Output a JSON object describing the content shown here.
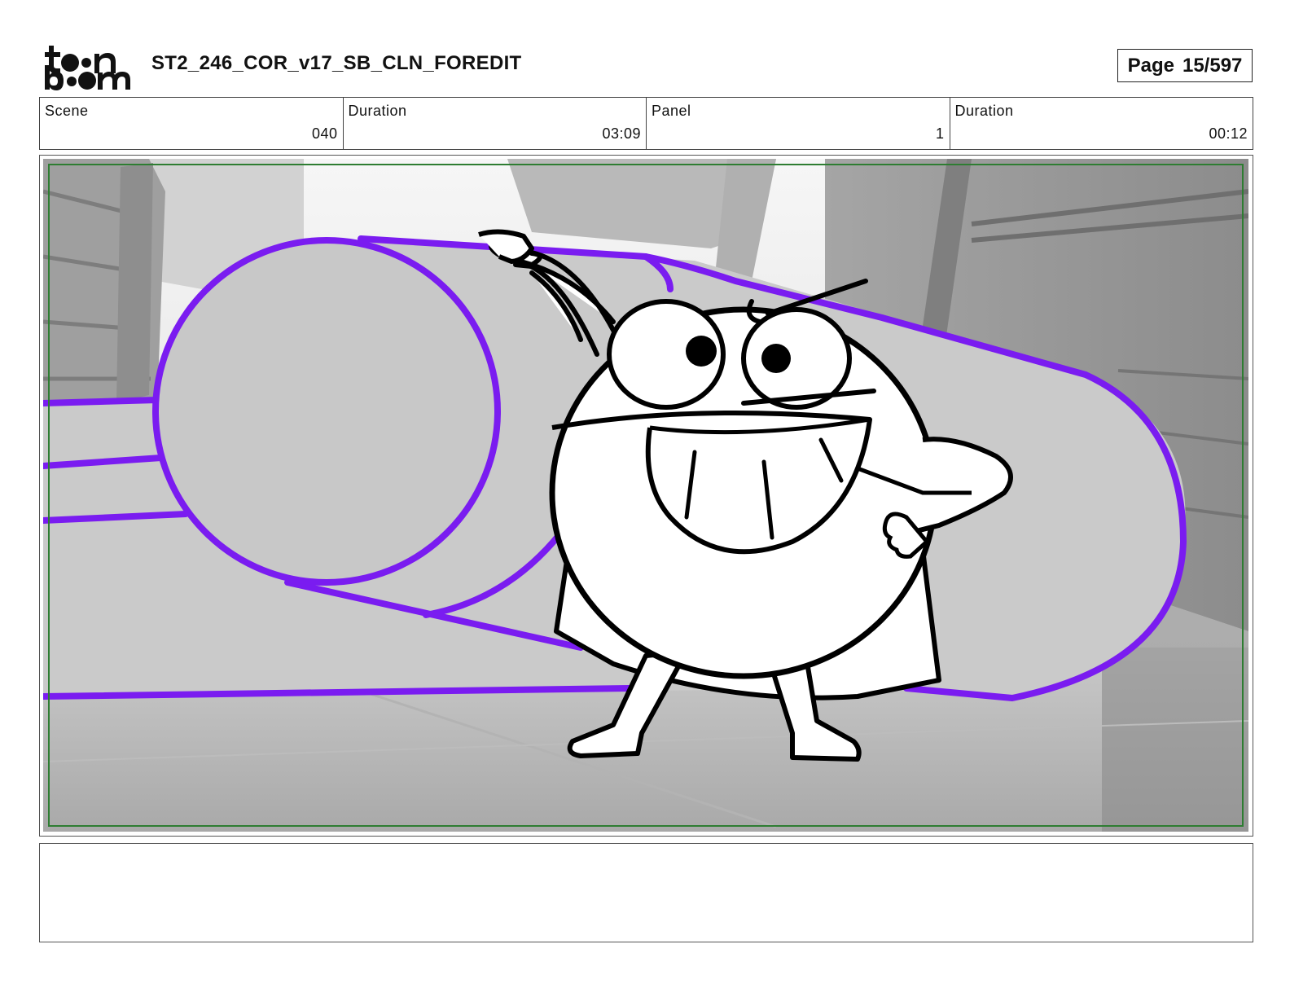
{
  "header": {
    "logo_text": "toon boom",
    "title": "ST2_246_COR_v17_SB_CLN_FOREDIT",
    "page_label": "Page",
    "page_number": "15/597"
  },
  "info": [
    {
      "label": "Scene",
      "value": "040"
    },
    {
      "label": "Duration",
      "value": "03:09"
    },
    {
      "label": "Panel",
      "value": "1"
    },
    {
      "label": "Duration",
      "value": "00:12"
    }
  ],
  "panel": {
    "description": "",
    "safe_frame_color": "#2e7d32",
    "guide_color": "#7a1cf0"
  },
  "notes": {
    "text": ""
  }
}
